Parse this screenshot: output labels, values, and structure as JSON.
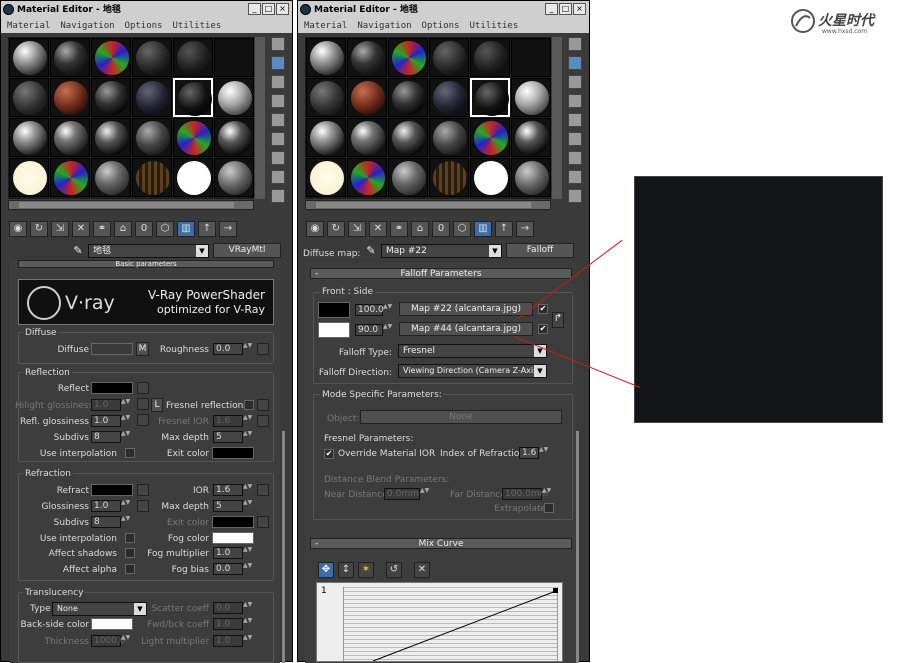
{
  "logo": {
    "text": "火星时代",
    "url_text": "www.hxsd.com"
  },
  "left_editor": {
    "title": "Material Editor - 地毯",
    "menu": [
      "Material",
      "Navigation",
      "Options",
      "Utilities"
    ],
    "material_name": "地毯",
    "material_type": "VRayMtl",
    "rollout_title": "Basic parameters",
    "banner": {
      "brand": "V·ray",
      "line1": "V-Ray PowerShader",
      "line2": "optimized for V-Ray"
    },
    "diffuse": {
      "group": "Diffuse",
      "label": "Diffuse",
      "m_label": "M",
      "roughness_label": "Roughness",
      "roughness": "0.0"
    },
    "reflection": {
      "group": "Reflection",
      "reflect_label": "Reflect",
      "hilight_label": "Hilight glossiness",
      "hilight_value": "1.0",
      "l_label": "L",
      "fresnel_label": "Fresnel reflections",
      "refl_gloss_label": "Refl. glossiness",
      "refl_gloss": "1.0",
      "fresnel_ior_label": "Fresnel IOR",
      "fresnel_ior": "1.6",
      "subdivs_label": "Subdivs",
      "subdivs": "8",
      "max_depth_label": "Max depth",
      "max_depth": "5",
      "use_interp_label": "Use interpolation",
      "exit_color_label": "Exit color"
    },
    "refraction": {
      "group": "Refraction",
      "refract_label": "Refract",
      "ior_label": "IOR",
      "ior": "1.6",
      "gloss_label": "Glossiness",
      "gloss": "1.0",
      "max_depth_label": "Max depth",
      "max_depth": "5",
      "subdivs_label": "Subdivs",
      "subdivs": "8",
      "exit_color_label": "Exit color",
      "use_interp_label": "Use interpolation",
      "fog_color_label": "Fog color",
      "affect_shadows_label": "Affect shadows",
      "fog_mult_label": "Fog multiplier",
      "fog_mult": "1.0",
      "affect_alpha_label": "Affect alpha",
      "fog_bias_label": "Fog bias",
      "fog_bias": "0.0"
    },
    "translucency": {
      "group": "Translucency",
      "type_label": "Type",
      "type_value": "None",
      "scatter_label": "Scatter coeff",
      "scatter": "0.0",
      "backside_label": "Back-side color",
      "fwd_label": "Fwd/bck coeff",
      "fwd": "1.0",
      "thickness_label": "Thickness",
      "thickness": "1000.0",
      "light_mult_label": "Light multiplier",
      "light_mult": "1.0"
    }
  },
  "right_editor": {
    "title": "Material Editor - 地毯",
    "menu": [
      "Material",
      "Navigation",
      "Options",
      "Utilities"
    ],
    "slot_label": "Diffuse map:",
    "map_name": "Map #22",
    "map_type": "Falloff",
    "falloff_rollout": "Falloff Parameters",
    "front_side_label": "Front : Side",
    "front_amount": "100.0",
    "front_map": "Map #22 (alcantara.jpg)",
    "side_amount": "90.0",
    "side_map": "Map #44 (alcantara.jpg)",
    "falloff_type_label": "Falloff Type:",
    "falloff_type": "Fresnel",
    "falloff_dir_label": "Falloff Direction:",
    "falloff_dir": "Viewing Direction (Camera Z-Axis)",
    "mode_label": "Mode Specific Parameters:",
    "object_label": "Object:",
    "object_value": "None",
    "fresnel_params_label": "Fresnel Parameters:",
    "override_ior_label": "Override Material IOR",
    "ior_label": "Index of Refraction",
    "ior": "1.6",
    "dist_blend_label": "Distance Blend Parameters:",
    "near_label": "Near Distance:",
    "near": "0.0mm",
    "far_label": "Far Distance:",
    "far": "100.0mm",
    "extrapolate_label": "Extrapolate",
    "mix_curve_rollout": "Mix Curve",
    "curve_axis_label": "1"
  },
  "colors": {
    "leader": "#d01818",
    "ui_bg": "#3a3a3a",
    "highlight": "#3b6ea8"
  }
}
